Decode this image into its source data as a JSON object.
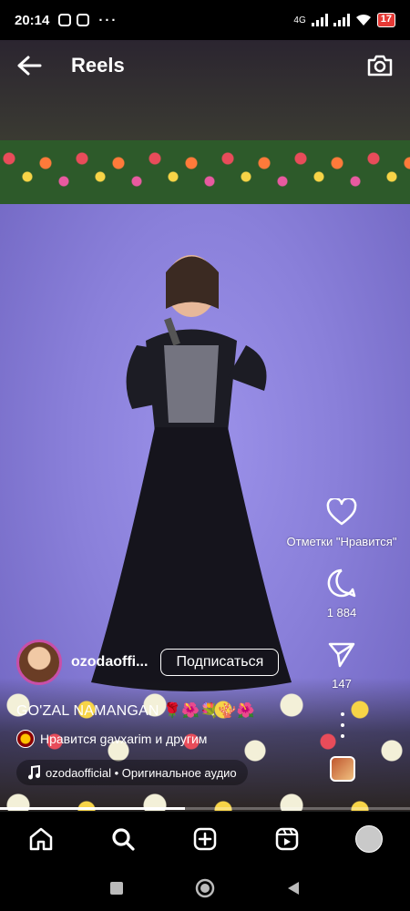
{
  "status_bar": {
    "time": "20:14",
    "dots": "···",
    "network": "4G",
    "battery": "17"
  },
  "header": {
    "title": "Reels",
    "back_icon": "arrow-left-icon",
    "camera_icon": "camera-icon"
  },
  "actions": {
    "likes_label": "Отметки \"Нравится\"",
    "comments_count": "1 884",
    "shares_count": "147"
  },
  "author": {
    "username": "ozodaoffi...",
    "follow_label": "Подписаться"
  },
  "caption": {
    "text": "GO'ZAL NAMANGAN 🌹🌺💐🪸🌺"
  },
  "liked_by": {
    "text": "Нравится gavxarim и другим"
  },
  "audio": {
    "text": "ozodaofficial • Оригинальное аудио"
  },
  "progress": {
    "fraction": 0.45
  },
  "bottom_nav": {
    "items": [
      "home-icon",
      "search-icon",
      "create-icon",
      "reels-icon",
      "profile-avatar"
    ]
  },
  "colors": {
    "accent": "#c84fa8",
    "stage": "#8f85e0",
    "battery": "#e53935"
  }
}
